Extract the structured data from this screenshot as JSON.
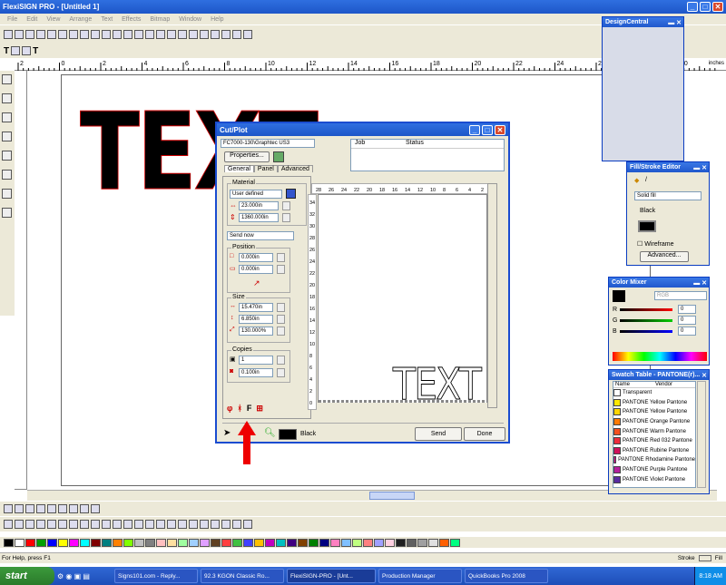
{
  "app": {
    "title": "FlexiSIGN PRO - [Untitled 1]"
  },
  "menu": [
    "File",
    "Edit",
    "View",
    "Arrange",
    "Text",
    "Effects",
    "Bitmap",
    "Window",
    "Help"
  ],
  "ruler": {
    "unit": "inches",
    "ticks": [
      "2",
      "0",
      "2",
      "4",
      "6",
      "8",
      "10",
      "12",
      "14",
      "16",
      "18",
      "20",
      "22",
      "24",
      "26",
      "28",
      "30"
    ]
  },
  "canvas": {
    "text": "TEXT"
  },
  "cutplot": {
    "title": "Cut/Plot",
    "device": "FC7000-130\\Graphtec US3",
    "properties_label": "Properties...",
    "job_header": "Job",
    "status_header": "Status",
    "tabs": [
      "General",
      "Panel",
      "Advanced"
    ],
    "material_label": "Material",
    "material_value": "User defined",
    "width": "23.000in",
    "length": "1360.000in",
    "send_mode": "Send now",
    "position_label": "Position",
    "pos_x": "0.000in",
    "pos_y": "0.000in",
    "size_label": "Size",
    "size_w": "15.470in",
    "size_h": "6.850in",
    "size_pct": "130.000%",
    "copies_label": "Copies",
    "copies": "1",
    "copies_gap": "0.100in",
    "ruler_top": [
      "28",
      "26",
      "24",
      "22",
      "20",
      "18",
      "16",
      "14",
      "12",
      "10",
      "8",
      "6",
      "4",
      "2"
    ],
    "ruler_side": [
      "34",
      "32",
      "30",
      "28",
      "26",
      "24",
      "22",
      "20",
      "18",
      "16",
      "14",
      "12",
      "10",
      "8",
      "6",
      "4",
      "2",
      "0"
    ],
    "preview_text": "TEXT",
    "color_label": "Black",
    "send_button": "Send",
    "done_button": "Done"
  },
  "design_central": {
    "title": "DesignCentral"
  },
  "fill_stroke": {
    "title": "Fill/Stroke Editor",
    "fill_type": "Solid fill",
    "color": "Black",
    "wireframe_label": "Wireframe",
    "advanced_button": "Advanced..."
  },
  "color_mixer": {
    "title": "Color Mixer",
    "model": "RGB",
    "r_label": "R",
    "g_label": "G",
    "b_label": "B",
    "r": "0",
    "g": "0",
    "b": "0"
  },
  "swatch": {
    "title": "Swatch Table - PANTONE(r)...",
    "col_name": "Name",
    "col_vendor": "Vendor",
    "items": [
      {
        "name": "Transparent",
        "color": "#ffffff"
      },
      {
        "name": "PANTONE Yellow Pantone",
        "color": "#ffe800"
      },
      {
        "name": "PANTONE Yellow Pantone",
        "color": "#ffd500"
      },
      {
        "name": "PANTONE Orange Pantone",
        "color": "#ff7a00"
      },
      {
        "name": "PANTONE Warm Pantone",
        "color": "#f5501e"
      },
      {
        "name": "PANTONE Red 032 Pantone",
        "color": "#ef2b3b"
      },
      {
        "name": "PANTONE Rubine Pantone",
        "color": "#d0105a"
      },
      {
        "name": "PANTONE Rhodamine Pantone",
        "color": "#e0109a"
      },
      {
        "name": "PANTONE Purple Pantone",
        "color": "#b4209c"
      },
      {
        "name": "PANTONE Violet Pantone",
        "color": "#5a2aa0"
      }
    ]
  },
  "status": {
    "help": "For Help, press F1",
    "stroke_label": "Stroke",
    "fill_label": "Fill"
  },
  "taskbar": {
    "start": "start",
    "time": "8:18 AM",
    "items": [
      "Signs101.com - Reply...",
      "92.3 KGON Classic Ro...",
      "FlexiSIGN-PRO - [Unt...",
      "Production Manager",
      "QuickBooks Pro 2008"
    ]
  },
  "palette_colors": [
    "#000000",
    "#ffffff",
    "#ff0000",
    "#00a000",
    "#0000ff",
    "#ffff00",
    "#ff00ff",
    "#00ffff",
    "#800000",
    "#008080",
    "#ff8000",
    "#80ff00",
    "#c0c0c0",
    "#808080",
    "#ffc0c0",
    "#ffe0a0",
    "#a0ffa0",
    "#a0d0ff",
    "#e0a0ff",
    "#604020",
    "#ff4040",
    "#40c040",
    "#4040ff",
    "#ffc000",
    "#c000c0",
    "#00c0c0",
    "#400080",
    "#804000",
    "#008000",
    "#000080",
    "#ff80c0",
    "#80c0ff",
    "#c0ff80",
    "#ff8080",
    "#a0a0ff",
    "#ffd0e0",
    "#202020",
    "#606060",
    "#a0a0a0",
    "#e0e0e0",
    "#ff6000",
    "#00ff80"
  ]
}
